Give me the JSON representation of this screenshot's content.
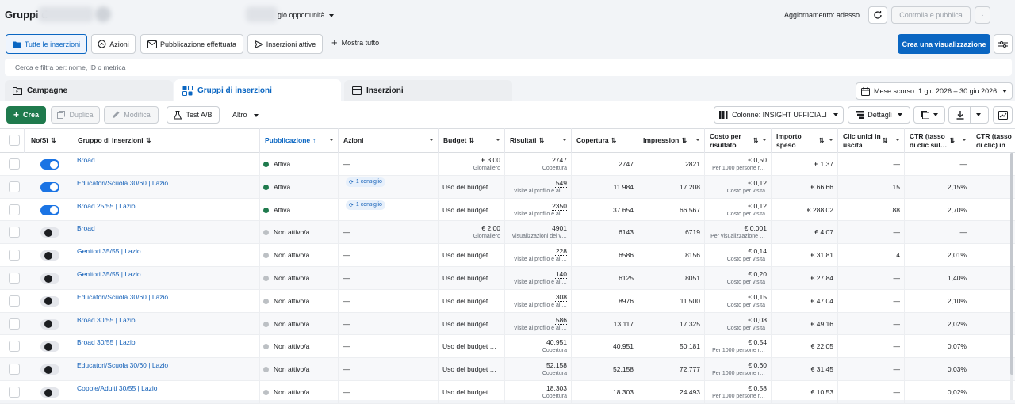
{
  "header": {
    "title": "Gruppi d",
    "objective": "gio opportunità",
    "update_status": "Aggiornamento: adesso",
    "review_publish": "Controlla e pubblica"
  },
  "filters": {
    "all_ads": "Tutte le inserzioni",
    "actions": "Azioni",
    "published": "Pubblicazione effettuata",
    "active_ads": "Inserzioni attive",
    "show_all": "Mostra tutto",
    "create_view": "Crea una visualizzazione"
  },
  "search": {
    "placeholder": "Cerca e filtra per: nome, ID o metrica"
  },
  "tabs": {
    "campaigns": "Campagne",
    "adsets": "Gruppi di inserzioni",
    "ads": "Inserzioni"
  },
  "date_range": "Mese scorso: 1 giu 2026 – 30 giu 2026",
  "toolbar": {
    "create": "Crea",
    "duplicate": "Duplica",
    "edit": "Modifica",
    "ab_test": "Test A/B",
    "more": "Altro",
    "columns": "Colonne: INSIGHT UFFICIALI",
    "breakdown": "Dettagli"
  },
  "columns": {
    "onoff": "No/Sì",
    "name": "Gruppo di inserzioni",
    "delivery": "Pubblicazione",
    "actions": "Azioni",
    "budget": "Budget",
    "results": "Risultati",
    "reach": "Copertura",
    "impressions": "Impression",
    "cpr1": "Costo per",
    "cpr2": "risultato",
    "spent1": "Importo",
    "spent2": "speso",
    "clicks1": "Clic unici in",
    "clicks2": "uscita",
    "ctr1": "CTR (tasso",
    "ctr2": "di clic sul…",
    "ctr3": "CTR (tasso",
    "ctr4": "di clic) in"
  },
  "rows": [
    {
      "on": true,
      "name": "Broad",
      "status": "Attiva",
      "active": true,
      "action": "—",
      "budget": "€ 3,00",
      "budget_sub": "Giornaliero",
      "result": "2747",
      "result_sub": "Copertura",
      "reach": "2747",
      "impr": "2821",
      "cost": "€ 0,50",
      "cost_sub": "Per 1000 persone r…",
      "spent": "€ 1,37",
      "clicks": "—",
      "ctr": "—"
    },
    {
      "on": true,
      "name": "Educatori/Scuola 30/60 | Lazio",
      "status": "Attiva",
      "active": true,
      "action": "1 consiglio",
      "budget": "Uso del budget …",
      "budget_sub": "",
      "result": "549",
      "result_sub": "Visite al profilo e all…",
      "reach": "11.984",
      "impr": "17.208",
      "cost": "€ 0,12",
      "cost_sub": "Costo per visita",
      "spent": "€ 66,66",
      "clicks": "15",
      "ctr": "2,15%"
    },
    {
      "on": true,
      "name": "Broad 25/55 | Lazio",
      "status": "Attiva",
      "active": true,
      "action": "1 consiglio",
      "budget": "Uso del budget …",
      "budget_sub": "",
      "result": "2350",
      "result_sub": "Visite al profilo e all…",
      "reach": "37.654",
      "impr": "66.567",
      "cost": "€ 0,12",
      "cost_sub": "Costo per visita",
      "spent": "€ 288,02",
      "clicks": "88",
      "ctr": "2,70%"
    },
    {
      "on": false,
      "name": "Broad",
      "status": "Non attivo/a",
      "active": false,
      "action": "—",
      "budget": "€ 2,00",
      "budget_sub": "Giornaliero",
      "result": "4901",
      "result_sub": "Visualizzazioni del v…",
      "reach": "6143",
      "impr": "6719",
      "cost": "€ 0,001",
      "cost_sub": "Per visualizzazione …",
      "spent": "€ 4,07",
      "clicks": "—",
      "ctr": "—"
    },
    {
      "on": false,
      "name": "Genitori 35/55 | Lazio",
      "status": "Non attivo/a",
      "active": false,
      "action": "—",
      "budget": "Uso del budget …",
      "budget_sub": "",
      "result": "228",
      "result_sub": "Visite al profilo e all…",
      "reach": "6586",
      "impr": "8156",
      "cost": "€ 0,14",
      "cost_sub": "Costo per visita",
      "spent": "€ 31,81",
      "clicks": "4",
      "ctr": "2,01%"
    },
    {
      "on": false,
      "name": "Genitori 35/55 | Lazio",
      "status": "Non attivo/a",
      "active": false,
      "action": "—",
      "budget": "Uso del budget …",
      "budget_sub": "",
      "result": "140",
      "result_sub": "Visite al profilo e all…",
      "reach": "6125",
      "impr": "8051",
      "cost": "€ 0,20",
      "cost_sub": "Costo per visita",
      "spent": "€ 27,84",
      "clicks": "—",
      "ctr": "1,40%"
    },
    {
      "on": false,
      "name": "Educatori/Scuola 30/60 | Lazio",
      "status": "Non attivo/a",
      "active": false,
      "action": "—",
      "budget": "Uso del budget …",
      "budget_sub": "",
      "result": "308",
      "result_sub": "Visite al profilo e all…",
      "reach": "8976",
      "impr": "11.500",
      "cost": "€ 0,15",
      "cost_sub": "Costo per visita",
      "spent": "€ 47,04",
      "clicks": "—",
      "ctr": "2,10%"
    },
    {
      "on": false,
      "name": "Broad 30/55 | Lazio",
      "status": "Non attivo/a",
      "active": false,
      "action": "—",
      "budget": "Uso del budget …",
      "budget_sub": "",
      "result": "586",
      "result_sub": "Visite al profilo e all…",
      "reach": "13.117",
      "impr": "17.325",
      "cost": "€ 0,08",
      "cost_sub": "Costo per visita",
      "spent": "€ 49,16",
      "clicks": "—",
      "ctr": "2,02%"
    },
    {
      "on": false,
      "name": "Broad 30/55 | Lazio",
      "status": "Non attivo/a",
      "active": false,
      "action": "—",
      "budget": "Uso del budget …",
      "budget_sub": "",
      "result": "40.951",
      "result_sub": "Copertura",
      "reach": "40.951",
      "impr": "50.181",
      "cost": "€ 0,54",
      "cost_sub": "Per 1000 persone r…",
      "spent": "€ 22,05",
      "clicks": "—",
      "ctr": "0,07%"
    },
    {
      "on": false,
      "name": "Educatori/Scuola 30/60 | Lazio",
      "status": "Non attivo/a",
      "active": false,
      "action": "—",
      "budget": "Uso del budget …",
      "budget_sub": "",
      "result": "52.158",
      "result_sub": "Copertura",
      "reach": "52.158",
      "impr": "72.777",
      "cost": "€ 0,60",
      "cost_sub": "Per 1000 persone r…",
      "spent": "€ 31,45",
      "clicks": "—",
      "ctr": "0,03%"
    },
    {
      "on": false,
      "name": "Coppie/Adulti 30/55 | Lazio",
      "status": "Non attivo/a",
      "active": false,
      "action": "—",
      "budget": "Uso del budget …",
      "budget_sub": "",
      "result": "18.303",
      "result_sub": "Copertura",
      "reach": "18.303",
      "impr": "24.493",
      "cost": "€ 0,58",
      "cost_sub": "Per 1000 persone r…",
      "spent": "€ 10,53",
      "clicks": "—",
      "ctr": "0,02%"
    }
  ],
  "colors": {
    "accent": "#0a66c2",
    "active": "#1f7a4d",
    "inactive": "#bcc0c4",
    "link": "#1561b8"
  }
}
